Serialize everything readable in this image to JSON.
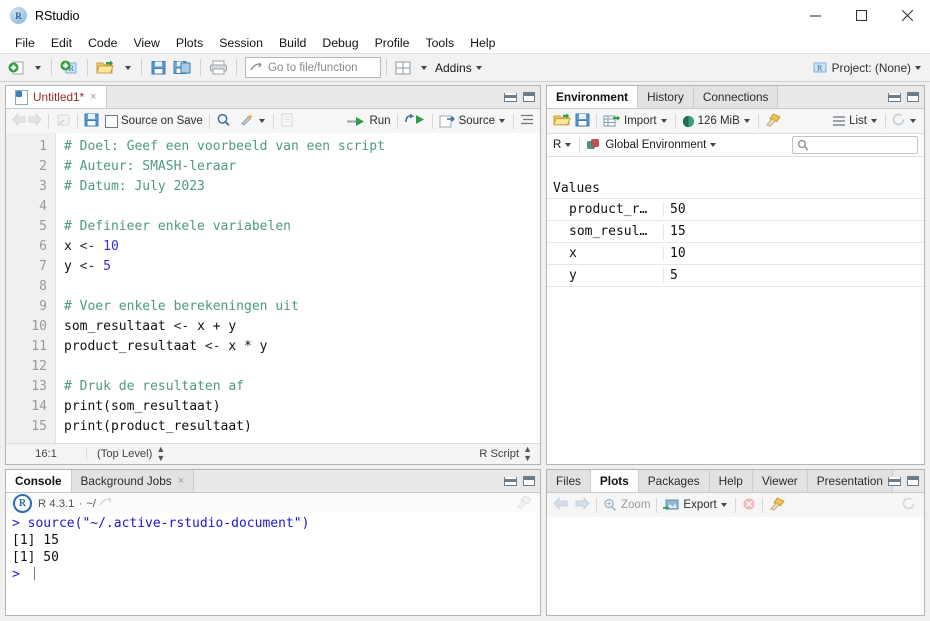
{
  "window": {
    "title": "RStudio",
    "app_icon": "r-logo-icon",
    "controls": {
      "minimize": "minimize-icon",
      "maximize": "maximize-icon",
      "close": "close-icon"
    }
  },
  "menubar": {
    "items": [
      "File",
      "Edit",
      "Code",
      "View",
      "Plots",
      "Session",
      "Build",
      "Debug",
      "Profile",
      "Tools",
      "Help"
    ]
  },
  "toolbar": {
    "new_file": "new-file-icon",
    "new_project": "new-project-icon",
    "open_file": "open-folder-icon",
    "save": "save-icon",
    "save_all": "save-all-icon",
    "print": "print-icon",
    "goto_placeholder": "Go to file/function",
    "panes_icon": "workspace-panes-icon",
    "addins_label": "Addins",
    "project_label": "Project: (None)"
  },
  "source_pane": {
    "tab": {
      "label": "Untitled1*",
      "close": "×"
    },
    "toolbar": {
      "back": "back-arrow-icon",
      "forward": "forward-arrow-icon",
      "popout": "show-in-new-window-icon",
      "save": "save-icon",
      "source_on_save_label": "Source on Save",
      "find": "magnifier-icon",
      "magic": "code-tools-icon",
      "compile_report": "compile-report-icon",
      "run_label": "Run",
      "rerun": "rerun-icon",
      "source_label": "Source",
      "outline": "document-outline-icon"
    },
    "lines": [
      {
        "n": "1",
        "tokens": [
          {
            "t": "# Doel: Geef een voorbeeld van een script",
            "c": "cm"
          }
        ]
      },
      {
        "n": "2",
        "tokens": [
          {
            "t": "# Auteur: SMASH-leraar",
            "c": "cm"
          }
        ]
      },
      {
        "n": "3",
        "tokens": [
          {
            "t": "# Datum: July 2023",
            "c": "cm"
          }
        ]
      },
      {
        "n": "4",
        "tokens": []
      },
      {
        "n": "5",
        "tokens": [
          {
            "t": "# Definieer enkele variabelen",
            "c": "cm"
          }
        ]
      },
      {
        "n": "6",
        "tokens": [
          {
            "t": "x ",
            "c": ""
          },
          {
            "t": "<- ",
            "c": "op"
          },
          {
            "t": "10",
            "c": "num"
          }
        ]
      },
      {
        "n": "7",
        "tokens": [
          {
            "t": "y ",
            "c": ""
          },
          {
            "t": "<- ",
            "c": "op"
          },
          {
            "t": "5",
            "c": "num"
          }
        ]
      },
      {
        "n": "8",
        "tokens": []
      },
      {
        "n": "9",
        "tokens": [
          {
            "t": "# Voer enkele berekeningen uit",
            "c": "cm"
          }
        ]
      },
      {
        "n": "10",
        "tokens": [
          {
            "t": "som_resultaat ",
            "c": ""
          },
          {
            "t": "<- ",
            "c": "op"
          },
          {
            "t": "x + y",
            "c": ""
          }
        ]
      },
      {
        "n": "11",
        "tokens": [
          {
            "t": "product_resultaat ",
            "c": ""
          },
          {
            "t": "<- ",
            "c": "op"
          },
          {
            "t": "x * y",
            "c": ""
          }
        ]
      },
      {
        "n": "12",
        "tokens": []
      },
      {
        "n": "13",
        "tokens": [
          {
            "t": "# Druk de resultaten af",
            "c": "cm"
          }
        ]
      },
      {
        "n": "14",
        "tokens": [
          {
            "t": "print(som_resultaat)",
            "c": ""
          }
        ]
      },
      {
        "n": "15",
        "tokens": [
          {
            "t": "print(product_resultaat)",
            "c": ""
          }
        ]
      }
    ],
    "status": {
      "cursor": "16:1",
      "scope": "(Top Level)",
      "doc_type": "R Script"
    }
  },
  "environment_pane": {
    "tabs": [
      "Environment",
      "History",
      "Connections"
    ],
    "active_tab": "Environment",
    "toolbar": {
      "load": "open-workspace-icon",
      "save": "save-workspace-icon",
      "import_label": "Import",
      "memory_label": "126 MiB",
      "broom": "clear-objects-icon",
      "view_label": "List",
      "refresh": "refresh-icon"
    },
    "scope": {
      "language": "R",
      "env_label": "Global Environment",
      "env_icon": "global-environment-icon"
    },
    "search_placeholder": "",
    "section_title": "Values",
    "values": [
      {
        "name": "product_r…",
        "value": "50"
      },
      {
        "name": "som_resul…",
        "value": "15"
      },
      {
        "name": "x",
        "value": "10"
      },
      {
        "name": "y",
        "value": "5"
      }
    ]
  },
  "console_pane": {
    "tabs": [
      "Console",
      "Background Jobs"
    ],
    "active_tab": "Console",
    "background_jobs_close": "×",
    "header": {
      "r_icon": "r-logo-icon",
      "version": "R 4.3.1",
      "separator": "·",
      "path": "~/",
      "popout": "open-in-window-icon",
      "clear": "clear-console-icon"
    },
    "lines": [
      {
        "prompt": "> ",
        "text": "source(\"~/.active-rstudio-document\")",
        "cls": "cmd"
      },
      {
        "prompt": "",
        "text": "[1] 15",
        "cls": ""
      },
      {
        "prompt": "",
        "text": "[1] 50",
        "cls": ""
      },
      {
        "prompt": "> ",
        "text": "",
        "cls": ""
      }
    ]
  },
  "files_pane": {
    "tabs": [
      "Files",
      "Plots",
      "Packages",
      "Help",
      "Viewer",
      "Presentation"
    ],
    "active_tab": "Plots",
    "toolbar": {
      "back": "back-arrow-icon",
      "forward": "forward-arrow-icon",
      "zoom_label": "Zoom",
      "export_label": "Export",
      "remove": "remove-plot-icon",
      "clear_all": "clear-all-plots-icon",
      "refresh": "refresh-icon"
    }
  },
  "colors": {
    "comment": "#4e9a7e",
    "number": "#3b2bdd",
    "console_command": "#1a1ad0",
    "tab_modified": "#9a2a2a",
    "accent_green": "#2f9e44",
    "accent_blue": "#2b6cb0"
  }
}
